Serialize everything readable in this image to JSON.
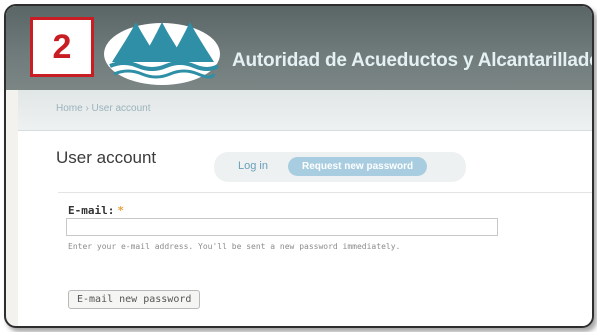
{
  "step_badge": {
    "number": "2"
  },
  "header": {
    "site_title": "Autoridad de Acueductos y Alcantarillados",
    "logo_icon": "water-drops-logo-icon"
  },
  "breadcrumb": "Home › User account",
  "page": {
    "title": "User account",
    "tabs": [
      {
        "label": "Log in",
        "active": false
      },
      {
        "label": "Request new password",
        "active": true
      }
    ]
  },
  "form": {
    "email_label": "E-mail:",
    "required_mark": "*",
    "email_value": "",
    "help_text": "Enter your e-mail address. You'll be sent a new password immediately.",
    "submit_label": "E-mail new password"
  },
  "colors": {
    "header_bg": "#6f7a7a",
    "badge_red": "#c71d23",
    "logo_blue": "#2f8fa6",
    "tab_active_bg": "#a9cde0",
    "required_star": "#e8a23a"
  }
}
